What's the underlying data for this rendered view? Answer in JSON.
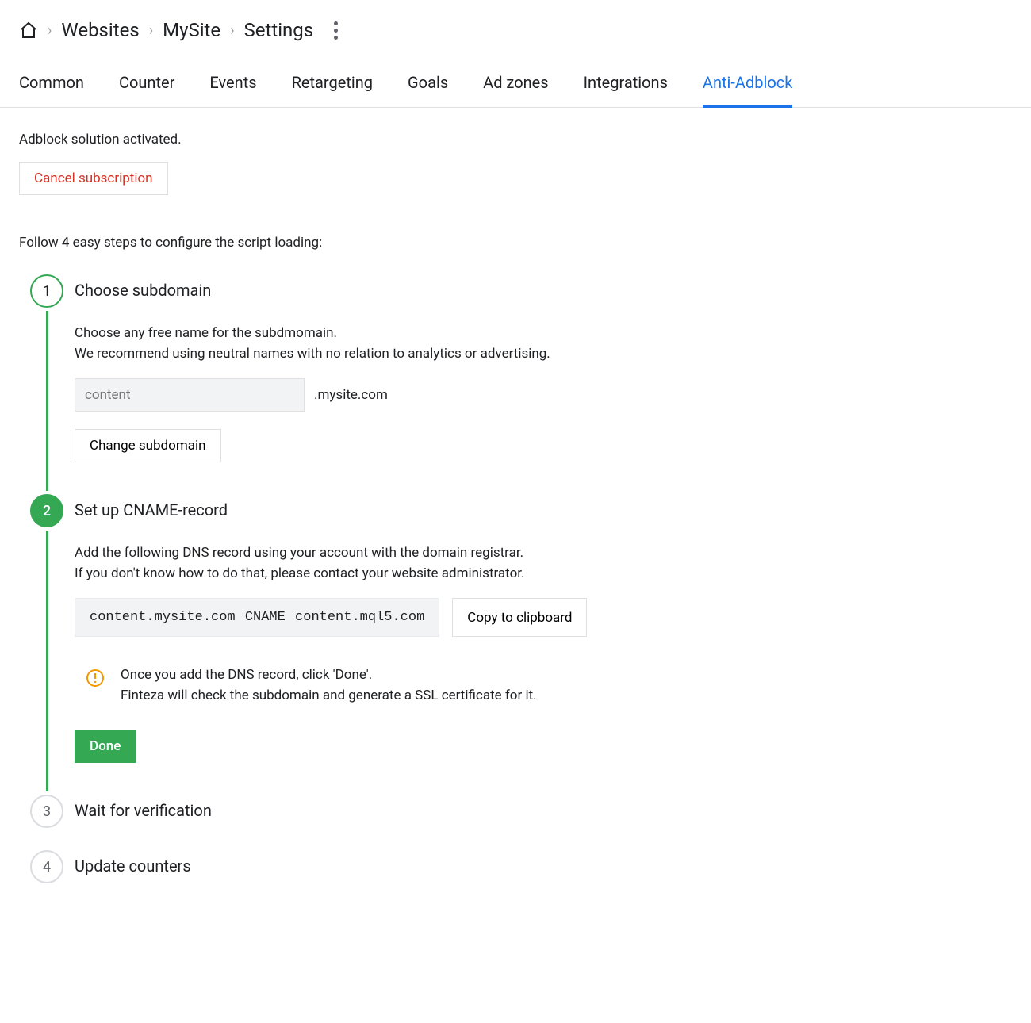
{
  "breadcrumb": {
    "items": [
      "Websites",
      "MySite",
      "Settings"
    ]
  },
  "tabs": {
    "items": [
      "Common",
      "Counter",
      "Events",
      "Retargeting",
      "Goals",
      "Ad zones",
      "Integrations",
      "Anti-Adblock"
    ],
    "active_index": 7
  },
  "content": {
    "status": "Adblock solution activated.",
    "cancel_label": "Cancel subscription",
    "intro": "Follow 4 easy steps to configure the script loading:"
  },
  "steps": [
    {
      "num": "1",
      "title": "Choose subdomain",
      "desc_line1": "Choose any free name for the subdmomain.",
      "desc_line2": "We recommend using neutral names with no relation to analytics or advertising.",
      "subdomain_placeholder": "content",
      "domain_suffix": ".mysite.com",
      "change_label": "Change subdomain"
    },
    {
      "num": "2",
      "title": "Set up CNAME-record",
      "desc_line1": "Add the following DNS record using your account with the domain registrar.",
      "desc_line2": "If you don't know how to do that, please contact your website administrator.",
      "cname_code": "content.mysite.com CNAME content.mql5.com",
      "copy_label": "Copy to clipboard",
      "alert_line1": "Once you add the DNS record, click 'Done'.",
      "alert_line2": "Finteza will check the subdomain and generate a SSL certificate for it.",
      "done_label": "Done"
    },
    {
      "num": "3",
      "title": "Wait for verification"
    },
    {
      "num": "4",
      "title": "Update counters"
    }
  ]
}
